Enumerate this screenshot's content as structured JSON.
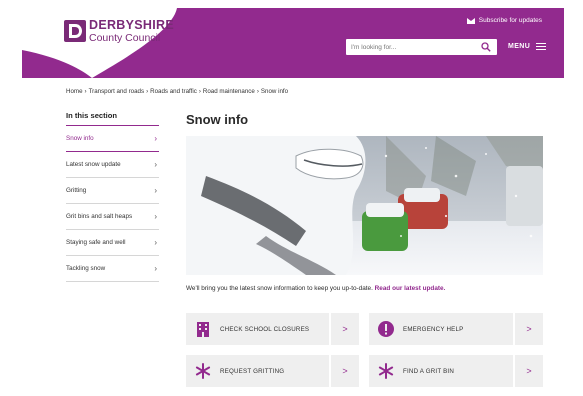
{
  "header": {
    "logo": {
      "name": "DERBYSHIRE",
      "sub": "County Council"
    },
    "subscribe_label": "Subscribe for updates",
    "search_placeholder": "I'm looking for...",
    "menu_label": "MENU"
  },
  "breadcrumb": [
    "Home",
    "Transport and roads",
    "Roads and traffic",
    "Road maintenance",
    "Snow info"
  ],
  "sidebar": {
    "title": "In this section",
    "items": [
      {
        "label": "Snow info",
        "active": true
      },
      {
        "label": "Latest snow update",
        "active": false
      },
      {
        "label": "Gritting",
        "active": false
      },
      {
        "label": "Grit bins and salt heaps",
        "active": false
      },
      {
        "label": "Staying safe and well",
        "active": false
      },
      {
        "label": "Tackling snow",
        "active": false
      }
    ]
  },
  "main": {
    "title": "Snow info",
    "intro_text": "We'll bring you the latest snow information to keep you up-to-date.",
    "intro_link": "Read our latest update.",
    "cards": [
      {
        "label": "CHECK SCHOOL CLOSURES",
        "icon": "school-building-icon"
      },
      {
        "label": "EMERGENCY HELP",
        "icon": "exclamation-icon"
      },
      {
        "label": "REQUEST GRITTING",
        "icon": "snowflake-icon"
      },
      {
        "label": "FIND A GRIT BIN",
        "icon": "snowflake-icon"
      }
    ],
    "card_arrow": ">"
  },
  "colors": {
    "brand": "#922a8e",
    "card_bg": "#efefef"
  }
}
